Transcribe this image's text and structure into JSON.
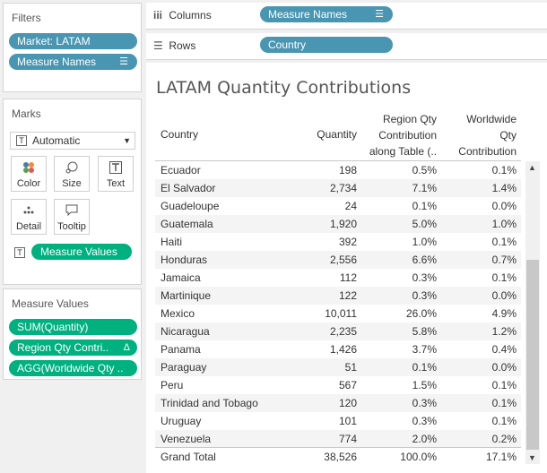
{
  "filters": {
    "title": "Filters",
    "pills": [
      "Market: LATAM",
      "Measure Names"
    ]
  },
  "shelves": {
    "columns": {
      "label": "Columns",
      "pill": "Measure Names"
    },
    "rows": {
      "label": "Rows",
      "pill": "Country"
    }
  },
  "marks": {
    "title": "Marks",
    "type": "Automatic",
    "buttons": [
      "Color",
      "Size",
      "Text",
      "Detail",
      "Tooltip"
    ],
    "measure_values_pill": "Measure Values"
  },
  "measure_values": {
    "title": "Measure Values",
    "pills": [
      "SUM(Quantity)",
      "Region Qty Contri..",
      "AGG(Worldwide Qty .."
    ]
  },
  "view": {
    "title": "LATAM Quantity Contributions",
    "headers": {
      "country": "Country",
      "quantity": "Quantity",
      "region": [
        "Region Qty",
        "Contribution",
        "along Table (.."
      ],
      "worldwide": [
        "Worldwide",
        "Qty",
        "Contribution"
      ]
    },
    "rows": [
      {
        "country": "Ecuador",
        "quantity": "198",
        "region": "0.5%",
        "worldwide": "0.1%"
      },
      {
        "country": "El Salvador",
        "quantity": "2,734",
        "region": "7.1%",
        "worldwide": "1.4%"
      },
      {
        "country": "Guadeloupe",
        "quantity": "24",
        "region": "0.1%",
        "worldwide": "0.0%"
      },
      {
        "country": "Guatemala",
        "quantity": "1,920",
        "region": "5.0%",
        "worldwide": "1.0%"
      },
      {
        "country": "Haiti",
        "quantity": "392",
        "region": "1.0%",
        "worldwide": "0.1%"
      },
      {
        "country": "Honduras",
        "quantity": "2,556",
        "region": "6.6%",
        "worldwide": "0.7%"
      },
      {
        "country": "Jamaica",
        "quantity": "112",
        "region": "0.3%",
        "worldwide": "0.1%"
      },
      {
        "country": "Martinique",
        "quantity": "122",
        "region": "0.3%",
        "worldwide": "0.0%"
      },
      {
        "country": "Mexico",
        "quantity": "10,011",
        "region": "26.0%",
        "worldwide": "4.9%"
      },
      {
        "country": "Nicaragua",
        "quantity": "2,235",
        "region": "5.8%",
        "worldwide": "1.2%"
      },
      {
        "country": "Panama",
        "quantity": "1,426",
        "region": "3.7%",
        "worldwide": "0.4%"
      },
      {
        "country": "Paraguay",
        "quantity": "51",
        "region": "0.1%",
        "worldwide": "0.0%"
      },
      {
        "country": "Peru",
        "quantity": "567",
        "region": "1.5%",
        "worldwide": "0.1%"
      },
      {
        "country": "Trinidad and Tobago",
        "quantity": "120",
        "region": "0.3%",
        "worldwide": "0.1%"
      },
      {
        "country": "Uruguay",
        "quantity": "101",
        "region": "0.3%",
        "worldwide": "0.1%"
      },
      {
        "country": "Venezuela",
        "quantity": "774",
        "region": "2.0%",
        "worldwide": "0.2%"
      }
    ],
    "grand_total": {
      "country": "Grand Total",
      "quantity": "38,526",
      "region": "100.0%",
      "worldwide": "17.1%"
    }
  }
}
